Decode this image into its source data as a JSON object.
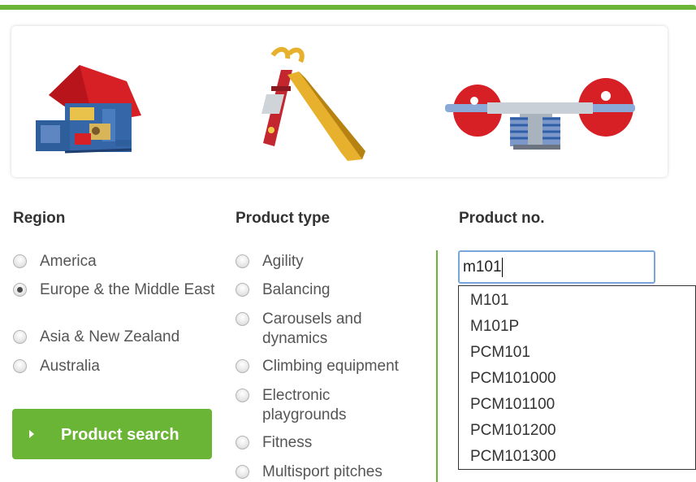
{
  "filters": {
    "region": {
      "title": "Region",
      "options": [
        {
          "label": "America",
          "checked": false
        },
        {
          "label": "Europe & the Middle East",
          "checked": true
        },
        {
          "label": "Asia & New Zealand",
          "checked": false
        },
        {
          "label": "Australia",
          "checked": false
        }
      ]
    },
    "product_type": {
      "title": "Product type",
      "options": [
        {
          "label": "Agility"
        },
        {
          "label": "Balancing"
        },
        {
          "label": "Carousels and dynamics"
        },
        {
          "label": "Climbing equipment"
        },
        {
          "label": "Electronic playgrounds"
        },
        {
          "label": "Fitness"
        },
        {
          "label": "Multisport pitches"
        }
      ]
    },
    "product_no": {
      "title": "Product no.",
      "value": "m101",
      "suggestions": [
        "M101",
        "M101P",
        "PCM101",
        "PCM101000",
        "PCM101100",
        "PCM101200",
        "PCM101300"
      ]
    }
  },
  "search_button": {
    "label": "Product search"
  },
  "colors": {
    "accent": "#6ab535",
    "input_border": "#7aa7db"
  }
}
